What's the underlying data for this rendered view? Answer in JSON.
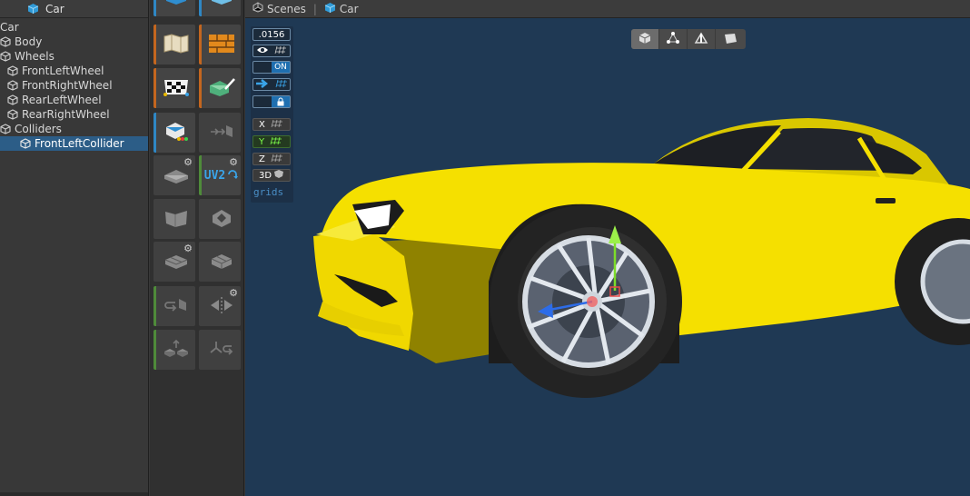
{
  "hierarchy": {
    "title": "Car",
    "items": [
      {
        "label": "Car",
        "indent": 0
      },
      {
        "label": "Body",
        "indent": 1
      },
      {
        "label": "Wheels",
        "indent": 1
      },
      {
        "label": "FrontLeftWheel",
        "indent": 2
      },
      {
        "label": "FrontRightWheel",
        "indent": 2
      },
      {
        "label": "RearLeftWheel",
        "indent": 2
      },
      {
        "label": "RearRightWheel",
        "indent": 2
      },
      {
        "label": "Colliders",
        "indent": 1
      },
      {
        "label": "FrontLeftCollider",
        "indent": 3,
        "selected": true
      }
    ]
  },
  "palette": {
    "uv2_label": "UV2"
  },
  "scene": {
    "breadcrumb_root": "Scenes",
    "breadcrumb_current": "Car",
    "overlay": {
      "snap_value": ".0156",
      "toggle_on": "ON",
      "axis_x": "X",
      "axis_y": "Y",
      "axis_z": "Z",
      "mode_3d": "3D",
      "grids_label": "grids"
    }
  },
  "colors": {
    "accent_selected": "#2c5d87",
    "scene_background": "#1f3954",
    "car_body": "#f5e000"
  }
}
